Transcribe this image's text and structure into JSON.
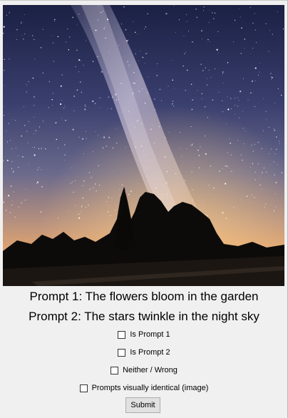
{
  "prompts": {
    "prompt1": "Prompt 1: The flowers bloom in the garden",
    "prompt2": "Prompt 2: The stars twinkle in the night sky"
  },
  "options": {
    "is_prompt_1": "Is Prompt 1",
    "is_prompt_2": "Is Prompt 2",
    "neither_wrong": "Neither / Wrong",
    "visually_identical": "Prompts visually identical (image)"
  },
  "submit_label": "Submit",
  "colors": {
    "window_bg": "#f0f0f0",
    "sky_top": "#1a1d3a",
    "horizon_glow": "#e8a26a"
  }
}
